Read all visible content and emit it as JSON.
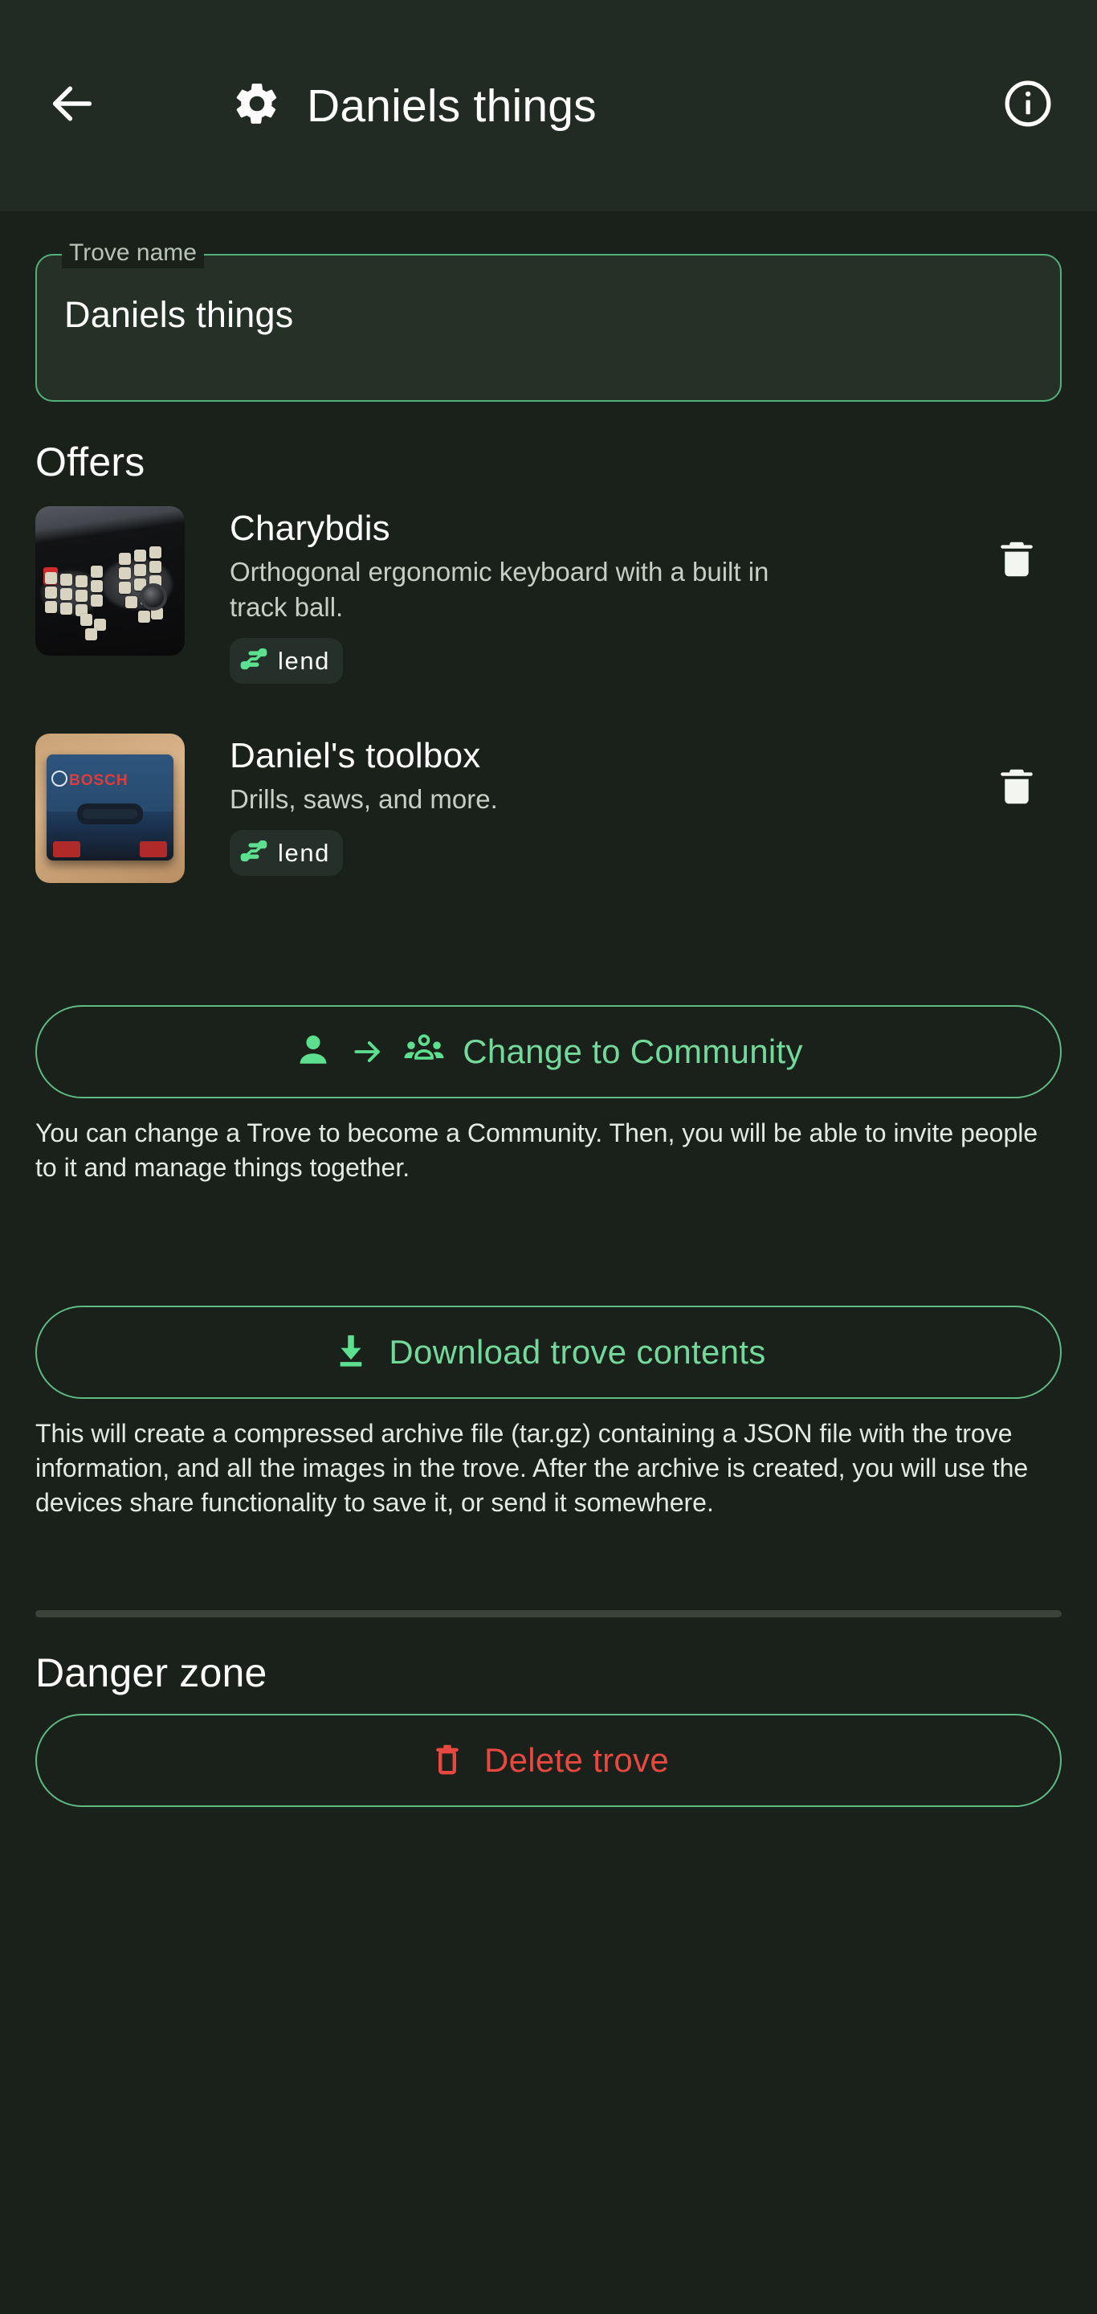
{
  "appbar": {
    "back_icon": "arrow-back-icon",
    "settings_icon": "gear-icon",
    "title": "Daniels things",
    "info_icon": "info-circle-icon"
  },
  "colors": {
    "background": "#1a211b",
    "appbar_background": "#222b23",
    "accent_green": "#73d99b",
    "outline_green": "#5fba83",
    "field_fill": "#253026",
    "danger_red": "#e8483f",
    "text_primary": "#ffffff",
    "text_secondary": "#c6cfc6",
    "divider": "#3a433a"
  },
  "trove_name_field": {
    "label": "Trove name",
    "value": "Daniels things",
    "placeholder": "Trove name"
  },
  "offers_section": {
    "title": "Offers",
    "items": [
      {
        "name": "Charybdis",
        "description": "Orthogonal ergonomic keyboard with a built in track ball.",
        "chip_label": "lend",
        "chip_icon": "hand-lend-icon",
        "thumbnail": "keyboard-photo",
        "delete_icon": "trash-icon"
      },
      {
        "name": "Daniel's toolbox",
        "description": "Drills, saws, and more.",
        "chip_label": "lend",
        "chip_icon": "hand-lend-icon",
        "thumbnail": "toolbox-photo",
        "delete_icon": "trash-icon"
      }
    ]
  },
  "change_community": {
    "button_label": "Change to Community",
    "person_icon": "person-icon",
    "arrow_icon": "arrow-right-icon",
    "group_icon": "people-group-icon",
    "helper_text": "You can change a Trove to become a Community. Then, you will be able to invite people to it and manage things together."
  },
  "download": {
    "button_label": "Download trove contents",
    "icon": "download-icon",
    "helper_text": "This will create a compressed archive file (tar.gz) containing a JSON file with the trove information, and all the images in the trove. After the archive is created, you will use the devices share functionality to save it, or send it somewhere."
  },
  "danger_zone": {
    "title": "Danger zone",
    "delete_button_label": "Delete trove",
    "delete_icon": "trash-outline-icon"
  }
}
